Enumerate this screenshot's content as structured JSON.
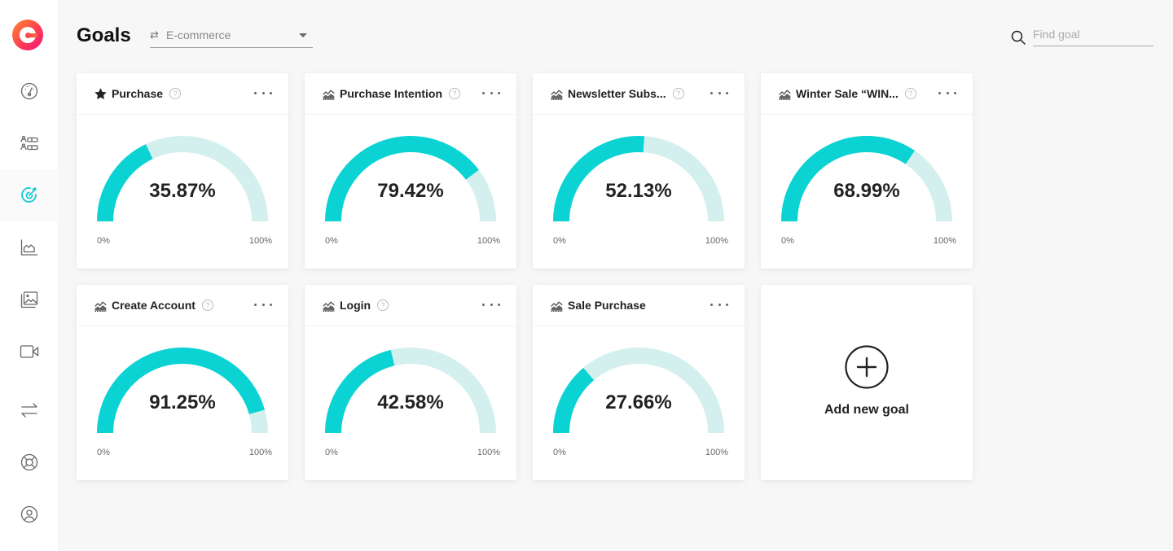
{
  "sidebar": {
    "logo": "app-logo",
    "items": [
      {
        "name": "dashboard",
        "icon": "gauge-icon",
        "active": false
      },
      {
        "name": "visitors",
        "icon": "user-list-icon",
        "active": false
      },
      {
        "name": "goals",
        "icon": "target-icon",
        "active": true
      },
      {
        "name": "analytics",
        "icon": "area-chart-icon",
        "active": false
      },
      {
        "name": "heatmaps",
        "icon": "images-icon",
        "active": false
      },
      {
        "name": "recordings",
        "icon": "video-icon",
        "active": false
      },
      {
        "name": "funnels",
        "icon": "swap-icon",
        "active": false
      },
      {
        "name": "support",
        "icon": "lifebuoy-icon",
        "active": false
      },
      {
        "name": "account",
        "icon": "user-circle-icon",
        "active": false
      }
    ]
  },
  "header": {
    "title": "Goals",
    "site_selector": {
      "icon": "swap-icon",
      "value": "E-commerce"
    },
    "search": {
      "placeholder": "Find goal",
      "value": ""
    }
  },
  "colors": {
    "gauge_fill": "#0bd3d3",
    "gauge_track": "#d3f0ef",
    "active_nav": "#14ccd0"
  },
  "goals": [
    {
      "title": "Purchase",
      "icon": "star-icon",
      "help": true,
      "value": 35.87,
      "value_label": "35.87%",
      "min_label": "0%",
      "max_label": "100%"
    },
    {
      "title": "Purchase Intention",
      "icon": "chart-icon",
      "help": true,
      "value": 79.42,
      "value_label": "79.42%",
      "min_label": "0%",
      "max_label": "100%"
    },
    {
      "title": "Newsletter Subs...",
      "icon": "chart-icon",
      "help": true,
      "value": 52.13,
      "value_label": "52.13%",
      "min_label": "0%",
      "max_label": "100%"
    },
    {
      "title": "Winter Sale “WIN...",
      "icon": "chart-icon",
      "help": true,
      "value": 68.99,
      "value_label": "68.99%",
      "min_label": "0%",
      "max_label": "100%"
    },
    {
      "title": "Create Account",
      "icon": "chart-icon",
      "help": true,
      "value": 91.25,
      "value_label": "91.25%",
      "min_label": "0%",
      "max_label": "100%"
    },
    {
      "title": "Login",
      "icon": "chart-icon",
      "help": true,
      "value": 42.58,
      "value_label": "42.58%",
      "min_label": "0%",
      "max_label": "100%"
    },
    {
      "title": "Sale Purchase",
      "icon": "chart-icon",
      "help": false,
      "value": 27.66,
      "value_label": "27.66%",
      "min_label": "0%",
      "max_label": "100%"
    }
  ],
  "help_glyph": "?",
  "add_goal": {
    "label": "Add new goal",
    "icon": "plus-circle-icon"
  }
}
